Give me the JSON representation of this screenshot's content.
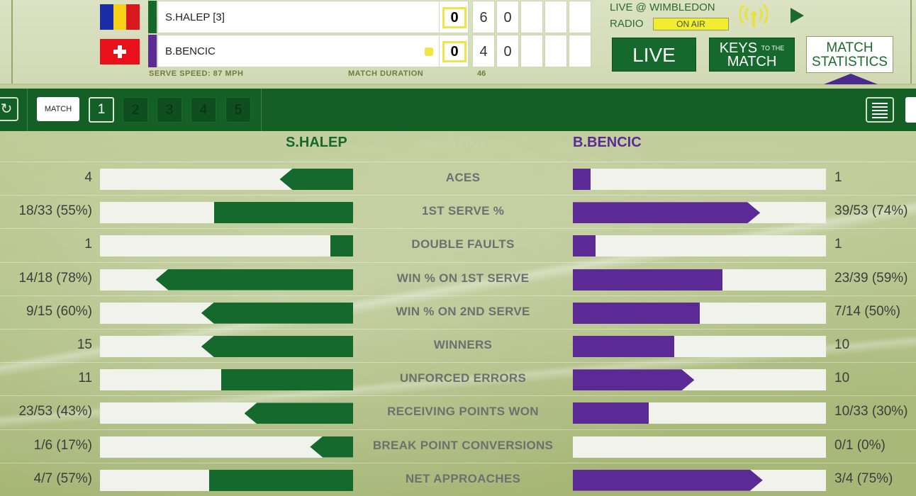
{
  "scoreboard": {
    "players": [
      {
        "name": "S.HALEP [3]",
        "flag": "Romania",
        "color": "#15692d",
        "points": "0",
        "sets": [
          "6",
          "0"
        ],
        "serving": false
      },
      {
        "name": "B.BENCIC",
        "flag": "Switzerland",
        "color": "#5c2a95",
        "points": "0",
        "sets": [
          "4",
          "0"
        ],
        "serving": true
      }
    ],
    "serve_speed_label": "SERVE SPEED: 87 MPH",
    "match_duration_label": "MATCH DURATION",
    "match_duration_value": "46",
    "radio_live_label": "LIVE @ WIMBLEDON",
    "radio_label": "RADIO",
    "on_air_label": "ON AIR",
    "live_button": "LIVE",
    "keys_button_line1": "KEYS",
    "keys_button_small": "TO THE",
    "keys_button_line2": "MATCH",
    "stats_button_line1": "MATCH",
    "stats_button_line2": "STATISTICS"
  },
  "toolbar": {
    "match_label": "MATCH",
    "sets": [
      "1",
      "2",
      "3",
      "4",
      "5"
    ],
    "active_set": "1",
    "refresh_icon": "refresh-icon",
    "list_icon": "list-view-icon",
    "chart_icon": "chart-view-icon"
  },
  "stats": {
    "left_player": "S.HALEP",
    "right_player": "B.BENCIC",
    "section_label": "MATCH STATS",
    "colors": {
      "left": "#15692d",
      "right": "#5c2a95"
    },
    "rows": [
      {
        "label": "ACES",
        "left": "4",
        "right": "1",
        "left_fill": 0.29,
        "right_fill": 0.07,
        "left_arrow": true,
        "right_arrow": false
      },
      {
        "label": "1ST SERVE %",
        "left": "18/33 (55%)",
        "right": "39/53 (74%)",
        "left_fill": 0.55,
        "right_fill": 0.74,
        "left_arrow": false,
        "right_arrow": true
      },
      {
        "label": "DOUBLE FAULTS",
        "left": "1",
        "right": "1",
        "left_fill": 0.09,
        "right_fill": 0.09,
        "left_arrow": false,
        "right_arrow": false
      },
      {
        "label": "WIN % ON 1ST SERVE",
        "left": "14/18 (78%)",
        "right": "23/39 (59%)",
        "left_fill": 0.78,
        "right_fill": 0.59,
        "left_arrow": true,
        "right_arrow": false
      },
      {
        "label": "WIN % ON 2ND SERVE",
        "left": "9/15 (60%)",
        "right": "7/14 (50%)",
        "left_fill": 0.6,
        "right_fill": 0.5,
        "left_arrow": true,
        "right_arrow": false
      },
      {
        "label": "WINNERS",
        "left": "15",
        "right": "10",
        "left_fill": 0.6,
        "right_fill": 0.4,
        "left_arrow": true,
        "right_arrow": false
      },
      {
        "label": "UNFORCED ERRORS",
        "left": "11",
        "right": "10",
        "left_fill": 0.52,
        "right_fill": 0.48,
        "left_arrow": false,
        "right_arrow": true
      },
      {
        "label": "RECEIVING POINTS WON",
        "left": "23/53 (43%)",
        "right": "10/33 (30%)",
        "left_fill": 0.43,
        "right_fill": 0.3,
        "left_arrow": true,
        "right_arrow": false
      },
      {
        "label": "BREAK POINT CONVERSIONS",
        "left": "1/6 (17%)",
        "right": "0/1 (0%)",
        "left_fill": 0.17,
        "right_fill": 0.0,
        "left_arrow": true,
        "right_arrow": false
      },
      {
        "label": "NET APPROACHES",
        "left": "4/7 (57%)",
        "right": "3/4 (75%)",
        "left_fill": 0.57,
        "right_fill": 0.75,
        "left_arrow": false,
        "right_arrow": true
      }
    ]
  }
}
